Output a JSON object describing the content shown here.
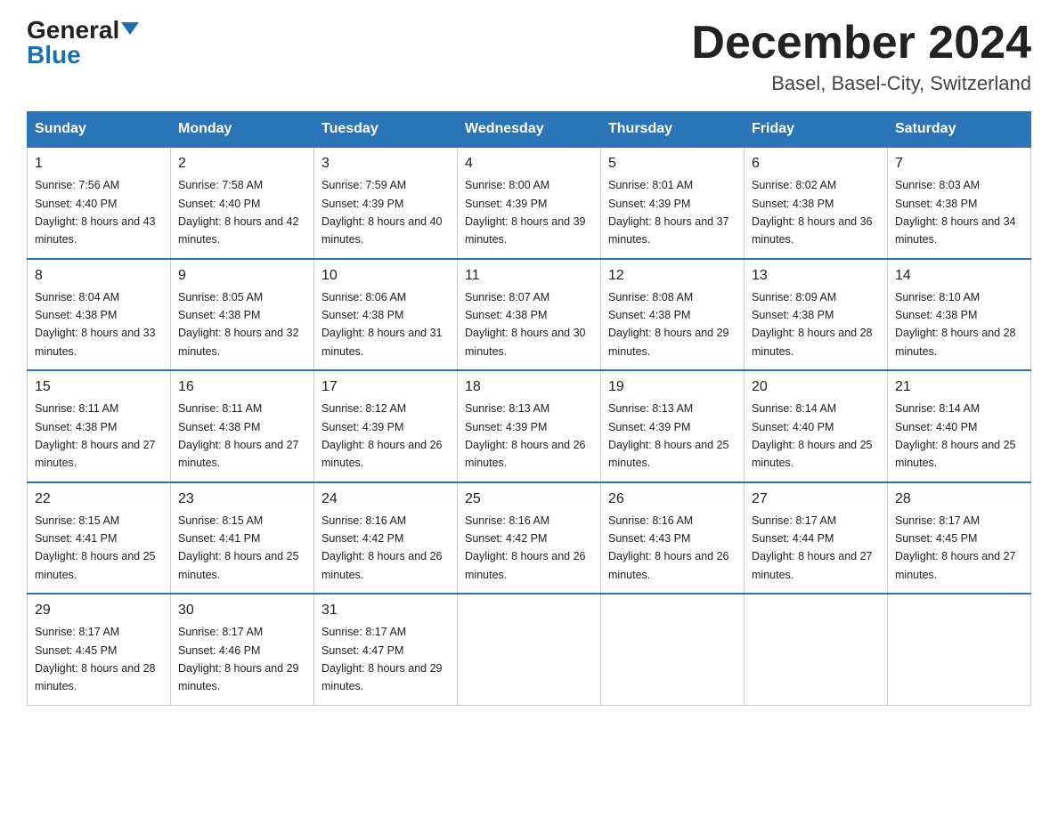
{
  "header": {
    "logo_general": "General",
    "logo_blue": "Blue",
    "month_title": "December 2024",
    "location": "Basel, Basel-City, Switzerland"
  },
  "days_of_week": [
    "Sunday",
    "Monday",
    "Tuesday",
    "Wednesday",
    "Thursday",
    "Friday",
    "Saturday"
  ],
  "weeks": [
    [
      {
        "day": "1",
        "sunrise": "7:56 AM",
        "sunset": "4:40 PM",
        "daylight": "8 hours and 43 minutes."
      },
      {
        "day": "2",
        "sunrise": "7:58 AM",
        "sunset": "4:40 PM",
        "daylight": "8 hours and 42 minutes."
      },
      {
        "day": "3",
        "sunrise": "7:59 AM",
        "sunset": "4:39 PM",
        "daylight": "8 hours and 40 minutes."
      },
      {
        "day": "4",
        "sunrise": "8:00 AM",
        "sunset": "4:39 PM",
        "daylight": "8 hours and 39 minutes."
      },
      {
        "day": "5",
        "sunrise": "8:01 AM",
        "sunset": "4:39 PM",
        "daylight": "8 hours and 37 minutes."
      },
      {
        "day": "6",
        "sunrise": "8:02 AM",
        "sunset": "4:38 PM",
        "daylight": "8 hours and 36 minutes."
      },
      {
        "day": "7",
        "sunrise": "8:03 AM",
        "sunset": "4:38 PM",
        "daylight": "8 hours and 34 minutes."
      }
    ],
    [
      {
        "day": "8",
        "sunrise": "8:04 AM",
        "sunset": "4:38 PM",
        "daylight": "8 hours and 33 minutes."
      },
      {
        "day": "9",
        "sunrise": "8:05 AM",
        "sunset": "4:38 PM",
        "daylight": "8 hours and 32 minutes."
      },
      {
        "day": "10",
        "sunrise": "8:06 AM",
        "sunset": "4:38 PM",
        "daylight": "8 hours and 31 minutes."
      },
      {
        "day": "11",
        "sunrise": "8:07 AM",
        "sunset": "4:38 PM",
        "daylight": "8 hours and 30 minutes."
      },
      {
        "day": "12",
        "sunrise": "8:08 AM",
        "sunset": "4:38 PM",
        "daylight": "8 hours and 29 minutes."
      },
      {
        "day": "13",
        "sunrise": "8:09 AM",
        "sunset": "4:38 PM",
        "daylight": "8 hours and 28 minutes."
      },
      {
        "day": "14",
        "sunrise": "8:10 AM",
        "sunset": "4:38 PM",
        "daylight": "8 hours and 28 minutes."
      }
    ],
    [
      {
        "day": "15",
        "sunrise": "8:11 AM",
        "sunset": "4:38 PM",
        "daylight": "8 hours and 27 minutes."
      },
      {
        "day": "16",
        "sunrise": "8:11 AM",
        "sunset": "4:38 PM",
        "daylight": "8 hours and 27 minutes."
      },
      {
        "day": "17",
        "sunrise": "8:12 AM",
        "sunset": "4:39 PM",
        "daylight": "8 hours and 26 minutes."
      },
      {
        "day": "18",
        "sunrise": "8:13 AM",
        "sunset": "4:39 PM",
        "daylight": "8 hours and 26 minutes."
      },
      {
        "day": "19",
        "sunrise": "8:13 AM",
        "sunset": "4:39 PM",
        "daylight": "8 hours and 25 minutes."
      },
      {
        "day": "20",
        "sunrise": "8:14 AM",
        "sunset": "4:40 PM",
        "daylight": "8 hours and 25 minutes."
      },
      {
        "day": "21",
        "sunrise": "8:14 AM",
        "sunset": "4:40 PM",
        "daylight": "8 hours and 25 minutes."
      }
    ],
    [
      {
        "day": "22",
        "sunrise": "8:15 AM",
        "sunset": "4:41 PM",
        "daylight": "8 hours and 25 minutes."
      },
      {
        "day": "23",
        "sunrise": "8:15 AM",
        "sunset": "4:41 PM",
        "daylight": "8 hours and 25 minutes."
      },
      {
        "day": "24",
        "sunrise": "8:16 AM",
        "sunset": "4:42 PM",
        "daylight": "8 hours and 26 minutes."
      },
      {
        "day": "25",
        "sunrise": "8:16 AM",
        "sunset": "4:42 PM",
        "daylight": "8 hours and 26 minutes."
      },
      {
        "day": "26",
        "sunrise": "8:16 AM",
        "sunset": "4:43 PM",
        "daylight": "8 hours and 26 minutes."
      },
      {
        "day": "27",
        "sunrise": "8:17 AM",
        "sunset": "4:44 PM",
        "daylight": "8 hours and 27 minutes."
      },
      {
        "day": "28",
        "sunrise": "8:17 AM",
        "sunset": "4:45 PM",
        "daylight": "8 hours and 27 minutes."
      }
    ],
    [
      {
        "day": "29",
        "sunrise": "8:17 AM",
        "sunset": "4:45 PM",
        "daylight": "8 hours and 28 minutes."
      },
      {
        "day": "30",
        "sunrise": "8:17 AM",
        "sunset": "4:46 PM",
        "daylight": "8 hours and 29 minutes."
      },
      {
        "day": "31",
        "sunrise": "8:17 AM",
        "sunset": "4:47 PM",
        "daylight": "8 hours and 29 minutes."
      },
      null,
      null,
      null,
      null
    ]
  ],
  "labels": {
    "sunrise": "Sunrise: ",
    "sunset": "Sunset: ",
    "daylight": "Daylight: "
  }
}
